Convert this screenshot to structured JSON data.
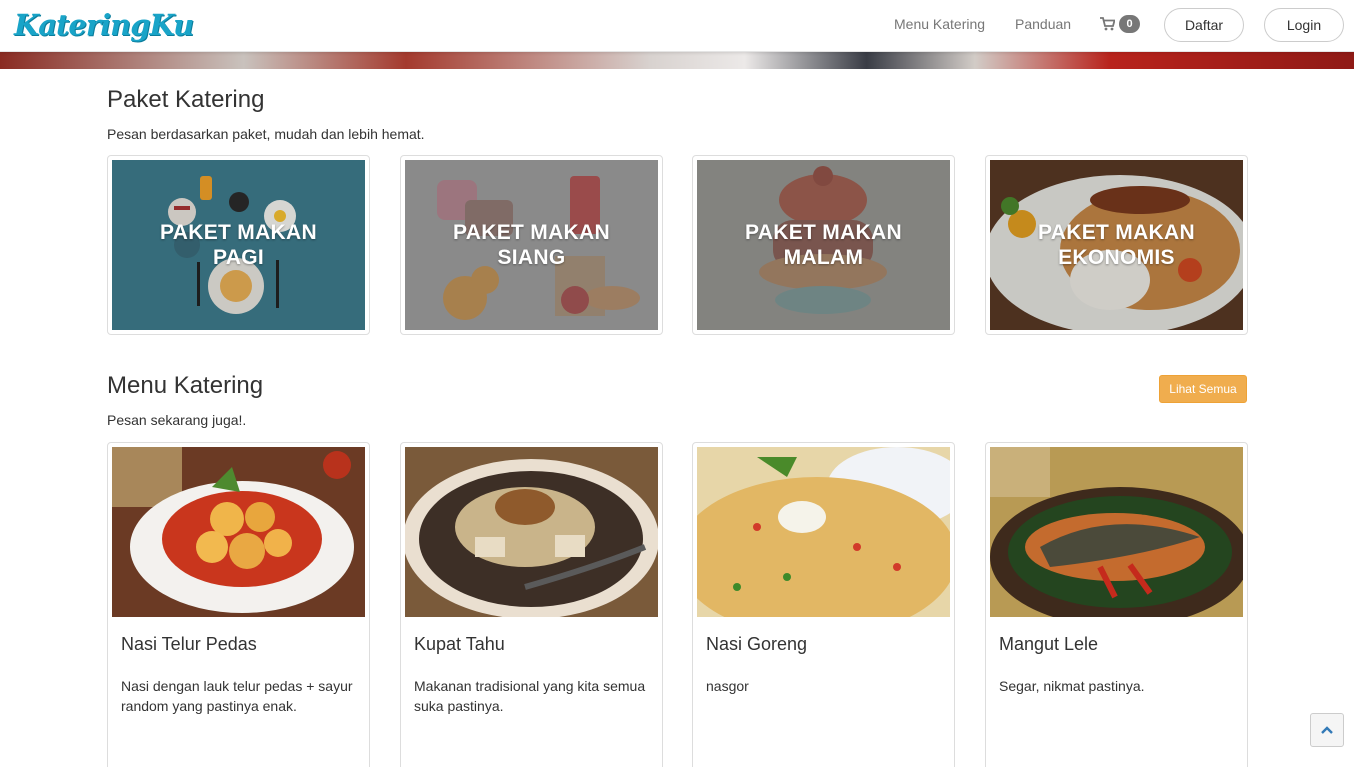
{
  "brand": {
    "name": "KateringKu"
  },
  "nav": {
    "menu_katering": "Menu Katering",
    "panduan": "Panduan",
    "cart_count": "0",
    "cart_icon": "cart-icon",
    "daftar": "Daftar",
    "login": "Login"
  },
  "paket": {
    "title": "Paket Katering",
    "subtitle": "Pesan berdasarkan paket, mudah dan lebih hemat.",
    "items": [
      {
        "label": "PAKET MAKAN PAGI",
        "bg": "#3a7a8c"
      },
      {
        "label": "PAKET MAKAN SIANG",
        "bg": "#8e8e8e"
      },
      {
        "label": "PAKET MAKAN MALAM",
        "bg": "#8a8a86"
      },
      {
        "label": "PAKET MAKAN EKONOMIS",
        "bg": "#a56b3a"
      }
    ]
  },
  "menu": {
    "title": "Menu Katering",
    "subtitle": "Pesan sekarang juga!.",
    "lihat_semua": "Lihat Semua",
    "items": [
      {
        "name": "Nasi Telur Pedas",
        "desc": "Nasi dengan lauk telur pedas + sayur random yang pastinya enak."
      },
      {
        "name": "Kupat Tahu",
        "desc": "Makanan tradisional yang kita semua suka pastinya."
      },
      {
        "name": "Nasi Goreng",
        "desc": "nasgor"
      },
      {
        "name": "Mangut Lele",
        "desc": "Segar, nikmat pastinya."
      }
    ]
  },
  "colors": {
    "brand": "#19a4c8",
    "warning_button": "#f0ad4e",
    "badge": "#777777"
  }
}
